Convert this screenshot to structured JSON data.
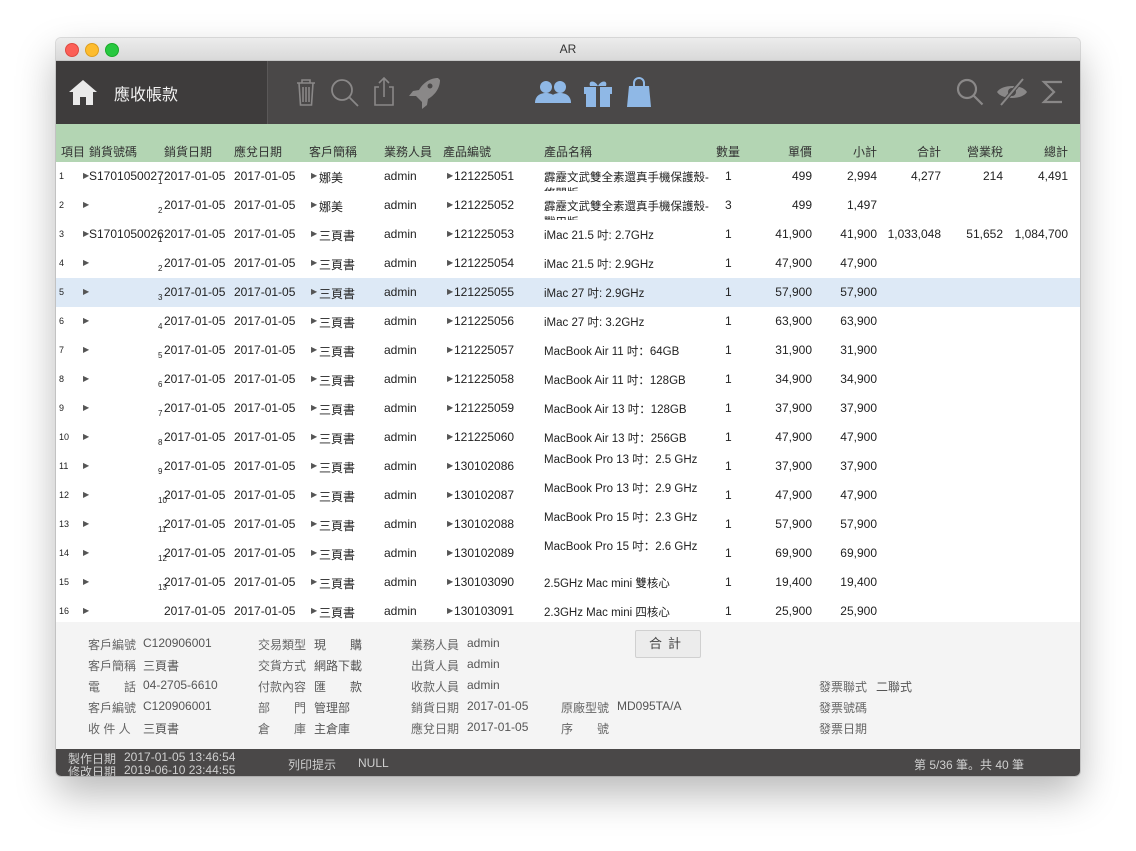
{
  "window": {
    "title": "AR"
  },
  "toolbar": {
    "title": "應收帳款"
  },
  "columns": [
    "項目",
    "銷貨號碼",
    "銷貨日期",
    "應兌日期",
    "客戶簡稱",
    "業務人員",
    "產品編號",
    "產品名稱",
    "數量",
    "單價",
    "小計",
    "合計",
    "營業稅",
    "總計"
  ],
  "rows": [
    {
      "idx": "1",
      "order": "S1701050027",
      "sub": "1",
      "date": "2017-01-05",
      "due": "2017-01-05",
      "cust": "娜美",
      "sales": "admin",
      "code": "121225051",
      "name": "霹靂文武雙全素還真手機保護殼- 悠閒版",
      "qty": "1",
      "price": "499",
      "subtotal": "2,994",
      "total": "4,277",
      "tax": "214",
      "grand": "4,491"
    },
    {
      "idx": "2",
      "order": "",
      "sub": "2",
      "date": "2017-01-05",
      "due": "2017-01-05",
      "cust": "娜美",
      "sales": "admin",
      "code": "121225052",
      "name": "霹靂文武雙全素還真手機保護殼- 戰甲版",
      "qty": "3",
      "price": "499",
      "subtotal": "1,497",
      "total": "",
      "tax": "",
      "grand": ""
    },
    {
      "idx": "3",
      "order": "S1701050026",
      "sub": "1",
      "date": "2017-01-05",
      "due": "2017-01-05",
      "cust": "三頁書",
      "sales": "admin",
      "code": "121225053",
      "name": "iMac 21.5 吋: 2.7GHz",
      "qty": "1",
      "price": "41,900",
      "subtotal": "41,900",
      "total": "1,033,048",
      "tax": "51,652",
      "grand": "1,084,700"
    },
    {
      "idx": "4",
      "order": "",
      "sub": "2",
      "date": "2017-01-05",
      "due": "2017-01-05",
      "cust": "三頁書",
      "sales": "admin",
      "code": "121225054",
      "name": "iMac 21.5 吋: 2.9GHz",
      "qty": "1",
      "price": "47,900",
      "subtotal": "47,900",
      "total": "",
      "tax": "",
      "grand": ""
    },
    {
      "idx": "5",
      "order": "",
      "sub": "3",
      "date": "2017-01-05",
      "due": "2017-01-05",
      "cust": "三頁書",
      "sales": "admin",
      "code": "121225055",
      "name": "iMac 27 吋: 2.9GHz",
      "qty": "1",
      "price": "57,900",
      "subtotal": "57,900",
      "total": "",
      "tax": "",
      "grand": ""
    },
    {
      "idx": "6",
      "order": "",
      "sub": "4",
      "date": "2017-01-05",
      "due": "2017-01-05",
      "cust": "三頁書",
      "sales": "admin",
      "code": "121225056",
      "name": "iMac 27 吋: 3.2GHz",
      "qty": "1",
      "price": "63,900",
      "subtotal": "63,900",
      "total": "",
      "tax": "",
      "grand": ""
    },
    {
      "idx": "7",
      "order": "",
      "sub": "5",
      "date": "2017-01-05",
      "due": "2017-01-05",
      "cust": "三頁書",
      "sales": "admin",
      "code": "121225057",
      "name": "MacBook Air 11 吋：64GB",
      "qty": "1",
      "price": "31,900",
      "subtotal": "31,900",
      "total": "",
      "tax": "",
      "grand": ""
    },
    {
      "idx": "8",
      "order": "",
      "sub": "6",
      "date": "2017-01-05",
      "due": "2017-01-05",
      "cust": "三頁書",
      "sales": "admin",
      "code": "121225058",
      "name": "MacBook Air 11 吋：128GB",
      "qty": "1",
      "price": "34,900",
      "subtotal": "34,900",
      "total": "",
      "tax": "",
      "grand": ""
    },
    {
      "idx": "9",
      "order": "",
      "sub": "7",
      "date": "2017-01-05",
      "due": "2017-01-05",
      "cust": "三頁書",
      "sales": "admin",
      "code": "121225059",
      "name": "MacBook Air 13 吋：128GB",
      "qty": "1",
      "price": "37,900",
      "subtotal": "37,900",
      "total": "",
      "tax": "",
      "grand": ""
    },
    {
      "idx": "10",
      "order": "",
      "sub": "8",
      "date": "2017-01-05",
      "due": "2017-01-05",
      "cust": "三頁書",
      "sales": "admin",
      "code": "121225060",
      "name": "MacBook Air 13 吋：256GB",
      "qty": "1",
      "price": "47,900",
      "subtotal": "47,900",
      "total": "",
      "tax": "",
      "grand": ""
    },
    {
      "idx": "11",
      "order": "",
      "sub": "9",
      "date": "2017-01-05",
      "due": "2017-01-05",
      "cust": "三頁書",
      "sales": "admin",
      "code": "130102086",
      "name": "MacBook Pro 13 吋：2.5 GHz",
      "qty": "1",
      "price": "37,900",
      "subtotal": "37,900",
      "total": "",
      "tax": "",
      "grand": ""
    },
    {
      "idx": "12",
      "order": "",
      "sub": "10",
      "date": "2017-01-05",
      "due": "2017-01-05",
      "cust": "三頁書",
      "sales": "admin",
      "code": "130102087",
      "name": "MacBook Pro 13 吋：2.9 GHz",
      "qty": "1",
      "price": "47,900",
      "subtotal": "47,900",
      "total": "",
      "tax": "",
      "grand": ""
    },
    {
      "idx": "13",
      "order": "",
      "sub": "11",
      "date": "2017-01-05",
      "due": "2017-01-05",
      "cust": "三頁書",
      "sales": "admin",
      "code": "130102088",
      "name": "MacBook Pro 15 吋：2.3 GHz",
      "qty": "1",
      "price": "57,900",
      "subtotal": "57,900",
      "total": "",
      "tax": "",
      "grand": ""
    },
    {
      "idx": "14",
      "order": "",
      "sub": "12",
      "date": "2017-01-05",
      "due": "2017-01-05",
      "cust": "三頁書",
      "sales": "admin",
      "code": "130102089",
      "name": "MacBook Pro 15 吋：2.6 GHz",
      "qty": "1",
      "price": "69,900",
      "subtotal": "69,900",
      "total": "",
      "tax": "",
      "grand": ""
    },
    {
      "idx": "15",
      "order": "",
      "sub": "13",
      "date": "2017-01-05",
      "due": "2017-01-05",
      "cust": "三頁書",
      "sales": "admin",
      "code": "130103090",
      "name": "2.5GHz Mac mini 雙核心",
      "qty": "1",
      "price": "19,400",
      "subtotal": "19,400",
      "total": "",
      "tax": "",
      "grand": ""
    },
    {
      "idx": "16",
      "order": "",
      "sub": "",
      "date": "2017-01-05",
      "due": "2017-01-05",
      "cust": "三頁書",
      "sales": "admin",
      "code": "130103091",
      "name": "2.3GHz Mac mini 四核心",
      "qty": "1",
      "price": "25,900",
      "subtotal": "25,900",
      "total": "",
      "tax": "",
      "grand": ""
    }
  ],
  "footer": {
    "cust_code_label": "客戶編號",
    "cust_code": "C120906001",
    "cust_name_label": "客戶簡稱",
    "cust_name": "三頁書",
    "phone_label": "電　　話",
    "phone": "04-2705-6610",
    "cust_code2_label": "客戶編號",
    "cust_code2": "C120906001",
    "receiver_label": "收 件 人",
    "receiver": "三頁書",
    "trade_type_label": "交易類型",
    "trade_type": "現　　購",
    "delivery_label": "交貨方式",
    "delivery": "網路下載",
    "payment_label": "付款內容",
    "payment": "匯　　款",
    "dept_label": "部　　門",
    "dept": "管理部",
    "warehouse_label": "倉　　庫",
    "warehouse": "主倉庫",
    "sales_label": "業務人員",
    "sales": "admin",
    "shipper_label": "出貨人員",
    "shipper": "admin",
    "collector_label": "收款人員",
    "collector": "admin",
    "sale_date_label": "銷貨日期",
    "sale_date": "2017-01-05",
    "due_date_label": "應兌日期",
    "due_date": "2017-01-05",
    "model_label": "原廠型號",
    "model": "MD095TA/A",
    "serial_label": "序　　號",
    "sum_button": "合計",
    "invoice_type_label": "發票聯式",
    "invoice_type": "二聯式",
    "invoice_no_label": "發票號碼",
    "invoice_date_label": "發票日期"
  },
  "status": {
    "created_label": "製作日期",
    "created": "2017-01-05  13:46:54",
    "modified_label": "修改日期",
    "modified": "2019-06-10  23:44:55",
    "print_label": "列印提示",
    "print_value": "NULL",
    "record": "第 5/36 筆。共 40 筆"
  }
}
